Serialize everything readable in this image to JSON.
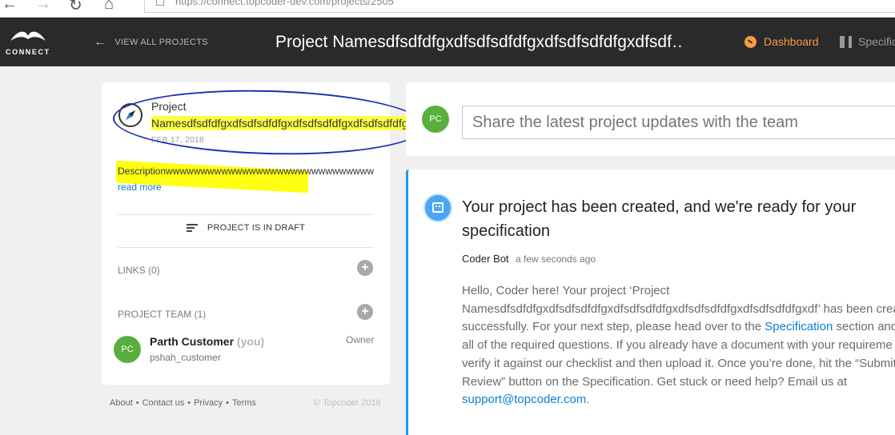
{
  "browser": {
    "url": "https://connect.topcoder-dev.com/projects/2505"
  },
  "header": {
    "logo_text": "CONNECT",
    "back_label": "VIEW ALL PROJECTS",
    "project_title": "Project Namesdfsdfdfgxdfsdfsdfdfgxdfsdfsdfdfgxdfsdf…",
    "dashboard_label": "Dashboard",
    "spec_label": "Specific"
  },
  "project": {
    "label": "Project",
    "name": "Namesdfsdfdfgxdfsdfsdfdfgxdfsdfsdfdfgxdfsdfsdfdfgxdf",
    "date": "FEB 17, 2018",
    "description": "Descriptionwwwwwwwwwwwwwwwwwwwwwwwwwwwwwwww",
    "read_more": "read more",
    "status": "PROJECT IS IN DRAFT"
  },
  "links": {
    "label": "LINKS (0)"
  },
  "team": {
    "label": "PROJECT TEAM (1)",
    "members": [
      {
        "initials": "PC",
        "name": "Parth Customer",
        "you": "(you)",
        "handle": "pshah_customer",
        "role": "Owner"
      }
    ]
  },
  "footer": {
    "about": "About",
    "contact": "Contact us",
    "privacy": "Privacy",
    "terms": "Terms",
    "sep": "•",
    "copyright": "© Topcoder 2018"
  },
  "share": {
    "avatar_initials": "PC",
    "placeholder": "Share the latest project updates with the team"
  },
  "post": {
    "title": "Your project has been created, and we're ready for your specification",
    "author": "Coder Bot",
    "time": "a few seconds ago",
    "line1": "Hello, Coder here! Your project ‘Project",
    "line2": "Namesdfsdfdfgxdfsdfsdfdfgxdfsdfsdfdfgxdfsdfsdfdfgxdfsdfsdfdfgxdf’ has been crea",
    "line3a": "successfully. For your next step, please head over to the ",
    "line3link": "Specification",
    "line3b": " section and",
    "line4": "all of the required questions. If you already have a document with your requireme",
    "line5": "verify it against our checklist and then upload it. Once you’re done, hit the “Submit",
    "line6": "Review” button on the Specification. Get stuck or need help? Email us at",
    "email": "support@topcoder.com",
    "email_end": "."
  },
  "colors": {
    "accent_orange": "#f79c3a",
    "link_blue": "#0b7fd1",
    "avatar_green": "#5aae3e",
    "topbar_dark": "#2a2a2c"
  }
}
